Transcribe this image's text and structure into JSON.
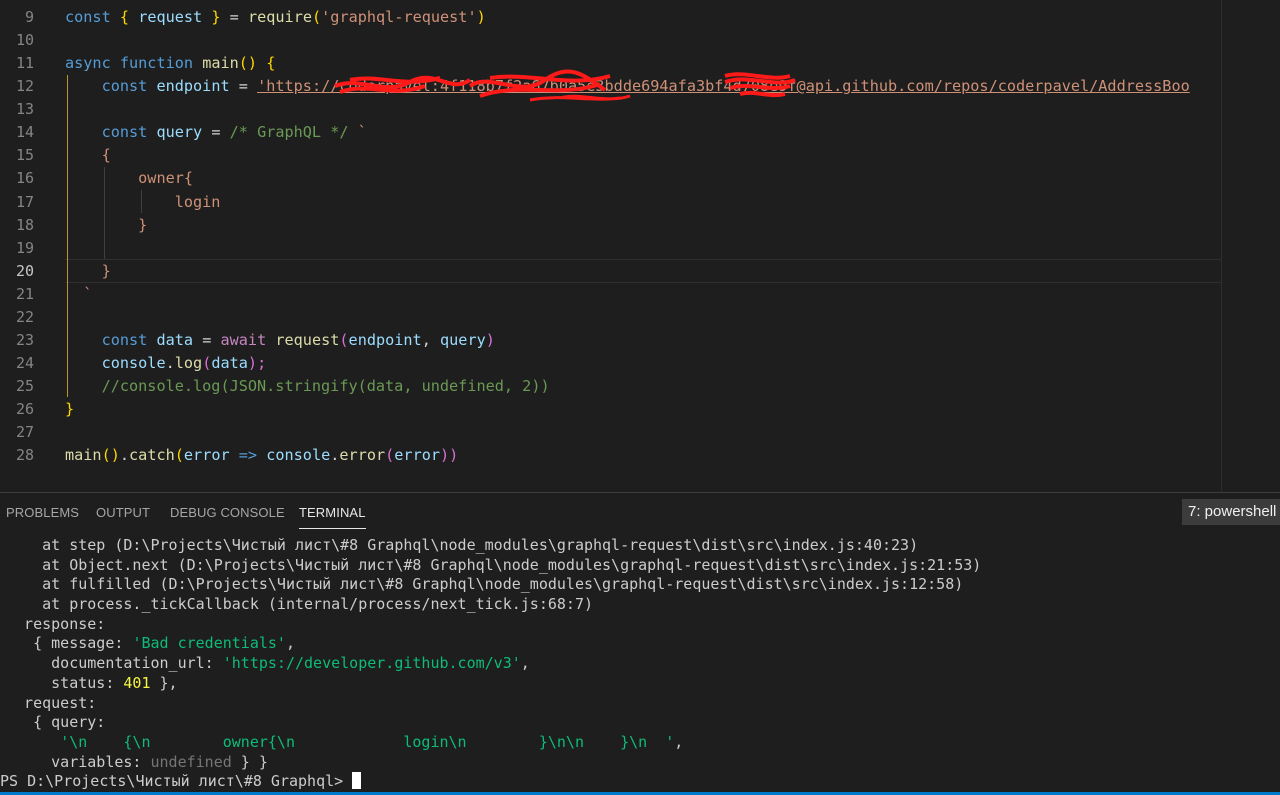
{
  "editor": {
    "line_numbers": [
      "9",
      "10",
      "11",
      "12",
      "13",
      "14",
      "15",
      "16",
      "17",
      "18",
      "19",
      "20",
      "21",
      "22",
      "23",
      "24",
      "25",
      "26",
      "27",
      "28"
    ],
    "active_line": "20",
    "code": {
      "l9": {
        "a": "const",
        "b": "{",
        "c": "request",
        "d": "}",
        "e": "=",
        "f": "require",
        "g": "(",
        "h": "'graphql-request'",
        "i": ")"
      },
      "l11": {
        "a": "async",
        "b": "function",
        "c": "main",
        "d": "()",
        "e": "{"
      },
      "l12": {
        "a": "const",
        "b": "endpoint",
        "c": "=",
        "d": "'https://coderpavel:4f118b7f2a67b0a5e3bdde694afa3bf4d708e9f@api.github.com/repos/coderpavel/AddressBoo"
      },
      "l14": {
        "a": "const",
        "b": "query",
        "c": "=",
        "d": "/* GraphQL */",
        "e": "`"
      },
      "l15": "{",
      "l16": "owner{",
      "l17": "login",
      "l18": "}",
      "l20": "}",
      "l21": "`",
      "l23": {
        "a": "const",
        "b": "data",
        "c": "=",
        "d": "await",
        "e": "request",
        "f": "(",
        "g": "endpoint",
        "h": ",",
        "i": "query",
        "j": ")"
      },
      "l24": {
        "a": "console",
        "b": ".",
        "c": "log",
        "d": "(",
        "e": "data",
        "f": ");"
      },
      "l25": "//console.log(JSON.stringify(data, undefined, 2))",
      "l26": "}",
      "l28": {
        "a": "main",
        "b": "()",
        "c": ".",
        "d": "catch",
        "e": "(",
        "f": "error",
        "g": "=>",
        "h": "console",
        "i": ".",
        "j": "error",
        "k": "(",
        "l": "error",
        "m": "))"
      }
    }
  },
  "panel": {
    "tabs": [
      "PROBLEMS",
      "OUTPUT",
      "DEBUG CONSOLE",
      "TERMINAL"
    ],
    "active_tab": "TERMINAL",
    "terminal_selector": "7: powershell",
    "lines": {
      "t1": "    at step (D:\\Projects\\Чистый лист\\#8 Graphql\\node_modules\\graphql-request\\dist\\src\\index.js:40:23)",
      "t2": "    at Object.next (D:\\Projects\\Чистый лист\\#8 Graphql\\node_modules\\graphql-request\\dist\\src\\index.js:21:53)",
      "t3": "    at fulfilled (D:\\Projects\\Чистый лист\\#8 Graphql\\node_modules\\graphql-request\\dist\\src\\index.js:12:58)",
      "t4": "    at process._tickCallback (internal/process/next_tick.js:68:7)",
      "t5": "  response:",
      "t6a": "   { message: ",
      "t6b": "'Bad credentials'",
      "t6c": ",",
      "t7a": "     documentation_url: ",
      "t7b": "'https://developer.github.com/v3'",
      "t7c": ",",
      "t8a": "     status: ",
      "t8b": "401",
      "t8c": " },",
      "t9": "  request:",
      "t10": "   { query:",
      "t11a": "      ",
      "t11b": "'\\n    {\\n        owner{\\n            login\\n        }\\n\\n    }\\n  '",
      "t11c": ",",
      "t12a": "     variables: ",
      "t12b": "undefined",
      "t12c": " } }",
      "prompt": "PS D:\\Projects\\Чистый лист\\#8 Graphql> "
    }
  },
  "colors": {
    "accent": "#007acc",
    "background": "#1e1e1e"
  }
}
